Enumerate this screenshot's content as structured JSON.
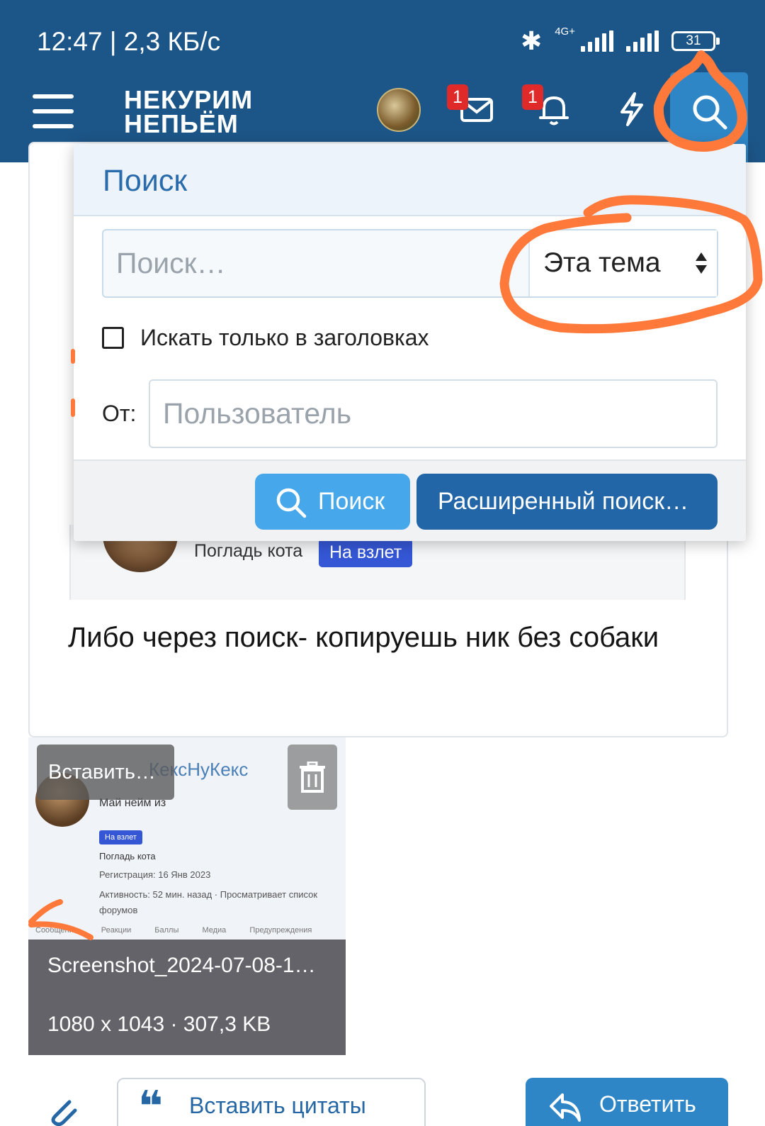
{
  "status_bar": {
    "time": "12:47 | 2,3 КБ/с",
    "network": "4G+",
    "battery": "31"
  },
  "header": {
    "logo_line1": "НЕКУРИМ",
    "logo_line2": "НЕПЬЁМ",
    "messages_badge": "1",
    "alerts_badge": "1"
  },
  "search_panel": {
    "title": "Поиск",
    "query_placeholder": "Поиск…",
    "scope_value": "Эта тема",
    "titles_only_label": "Искать только в заголовках",
    "from_label": "От:",
    "user_placeholder": "Пользователь",
    "search_button": "Поиск",
    "advanced_button": "Расширенный поиск…"
  },
  "post": {
    "quote_user_title": "Погладь кота",
    "quote_badge": "На взлет",
    "text": "Либо через поиск- копируешь ник без собаки"
  },
  "attachment": {
    "insert_label": "Вставить…",
    "file_name": "Screenshot_2024-07-08-1…",
    "meta": "1080 x 1043 · 307,3 KB",
    "preview": {
      "name": "КексНуКекс",
      "line1": "Май нейм из",
      "badge": "На взлет",
      "line2": "Погладь кота",
      "line3": "Регистрация: 16 Янв 2023",
      "line4": "Активность: 52 мин. назад · Просматривает список форумов",
      "tabs": "Сообщения Реакции Баллы Медиа Предупреждения"
    }
  },
  "bottom_bar": {
    "insert_quotes": "Вставить цитаты",
    "reply": "Ответить"
  },
  "colors": {
    "header_bg": "#1c5587",
    "accent": "#2f86c7",
    "annotation": "#ff7a3a"
  }
}
